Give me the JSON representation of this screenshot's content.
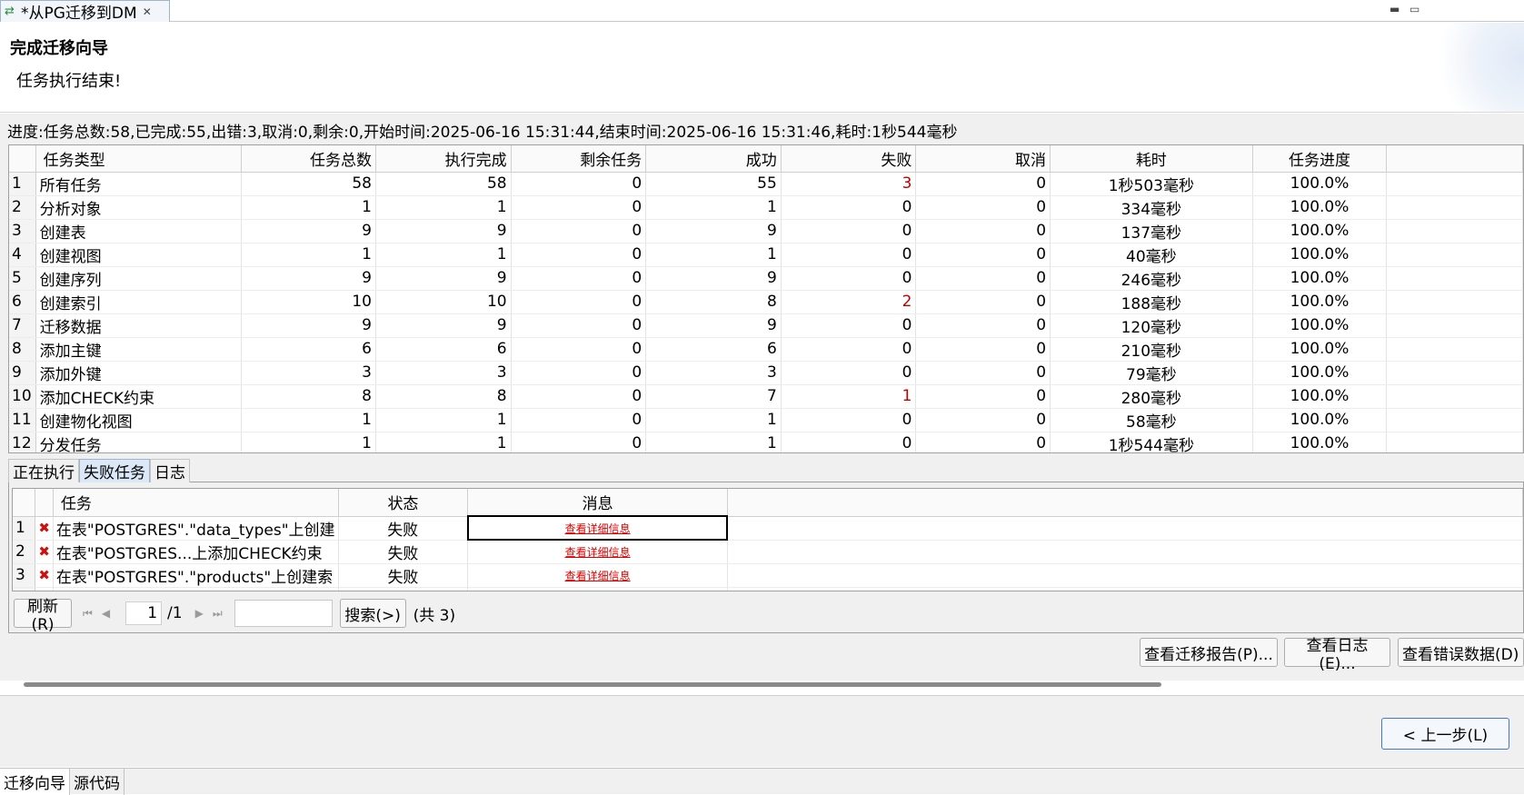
{
  "editor_tab": {
    "title": "*从PG迁移到DM"
  },
  "header": {
    "title": "完成迁移向导",
    "description": "任务执行结束!"
  },
  "progress": "进度:任务总数:58,已完成:55,出错:3,取消:0,剩余:0,开始时间:2025-06-16 15:31:44,结束时间:2025-06-16 15:31:46,耗时:1秒544毫秒",
  "task_grid": {
    "columns": [
      "任务类型",
      "任务总数",
      "执行完成",
      "剩余任务",
      "成功",
      "失败",
      "取消",
      "耗时",
      "任务进度"
    ],
    "rows": [
      {
        "no": "1",
        "type": "所有任务",
        "total": "58",
        "done": "58",
        "remain": "0",
        "success": "55",
        "fail": "3",
        "cancel": "0",
        "time": "1秒503毫秒",
        "progress": "100.0%"
      },
      {
        "no": "2",
        "type": "分析对象",
        "total": "1",
        "done": "1",
        "remain": "0",
        "success": "1",
        "fail": "0",
        "cancel": "0",
        "time": "334毫秒",
        "progress": "100.0%"
      },
      {
        "no": "3",
        "type": "创建表",
        "total": "9",
        "done": "9",
        "remain": "0",
        "success": "9",
        "fail": "0",
        "cancel": "0",
        "time": "137毫秒",
        "progress": "100.0%"
      },
      {
        "no": "4",
        "type": "创建视图",
        "total": "1",
        "done": "1",
        "remain": "0",
        "success": "1",
        "fail": "0",
        "cancel": "0",
        "time": "40毫秒",
        "progress": "100.0%"
      },
      {
        "no": "5",
        "type": "创建序列",
        "total": "9",
        "done": "9",
        "remain": "0",
        "success": "9",
        "fail": "0",
        "cancel": "0",
        "time": "246毫秒",
        "progress": "100.0%"
      },
      {
        "no": "6",
        "type": "创建索引",
        "total": "10",
        "done": "10",
        "remain": "0",
        "success": "8",
        "fail": "2",
        "cancel": "0",
        "time": "188毫秒",
        "progress": "100.0%"
      },
      {
        "no": "7",
        "type": "迁移数据",
        "total": "9",
        "done": "9",
        "remain": "0",
        "success": "9",
        "fail": "0",
        "cancel": "0",
        "time": "120毫秒",
        "progress": "100.0%"
      },
      {
        "no": "8",
        "type": "添加主键",
        "total": "6",
        "done": "6",
        "remain": "0",
        "success": "6",
        "fail": "0",
        "cancel": "0",
        "time": "210毫秒",
        "progress": "100.0%"
      },
      {
        "no": "9",
        "type": "添加外键",
        "total": "3",
        "done": "3",
        "remain": "0",
        "success": "3",
        "fail": "0",
        "cancel": "0",
        "time": "79毫秒",
        "progress": "100.0%"
      },
      {
        "no": "10",
        "type": "添加CHECK约束",
        "total": "8",
        "done": "8",
        "remain": "0",
        "success": "7",
        "fail": "1",
        "cancel": "0",
        "time": "280毫秒",
        "progress": "100.0%"
      },
      {
        "no": "11",
        "type": "创建物化视图",
        "total": "1",
        "done": "1",
        "remain": "0",
        "success": "1",
        "fail": "0",
        "cancel": "0",
        "time": "58毫秒",
        "progress": "100.0%"
      },
      {
        "no": "12",
        "type": "分发任务",
        "total": "1",
        "done": "1",
        "remain": "0",
        "success": "1",
        "fail": "0",
        "cancel": "0",
        "time": "1秒544毫秒",
        "progress": "100.0%"
      }
    ]
  },
  "lower_tabs": [
    "正在执行",
    "失败任务",
    "日志"
  ],
  "failed_grid": {
    "columns": [
      "任务",
      "状态",
      "消息"
    ],
    "rows": [
      {
        "no": "1",
        "task": "在表\"POSTGRES\".\"data_types\"上创建",
        "status": "失败",
        "msg": "查看详细信息"
      },
      {
        "no": "2",
        "task": "在表\"POSTGRES...上添加CHECK约束",
        "status": "失败",
        "msg": "查看详细信息"
      },
      {
        "no": "3",
        "task": "在表\"POSTGRES\".\"products\"上创建索",
        "status": "失败",
        "msg": "查看详细信息"
      }
    ]
  },
  "pager": {
    "refresh": "刷新(R)",
    "page": "1",
    "total_pages": "/1",
    "search": "搜索(>)",
    "count": "(共 3)"
  },
  "actions": {
    "report": "查看迁移报告(P)...",
    "log": "查看日志(E)...",
    "error_data": "查看错误数据(D)"
  },
  "nav": {
    "back": "< 上一步(L)"
  },
  "bottom_tabs": [
    "迁移向导",
    "源代码"
  ],
  "colors": {
    "fail_red": "#c00000",
    "link_red": "#e00000",
    "focus_blue": "#3d7bd1"
  }
}
